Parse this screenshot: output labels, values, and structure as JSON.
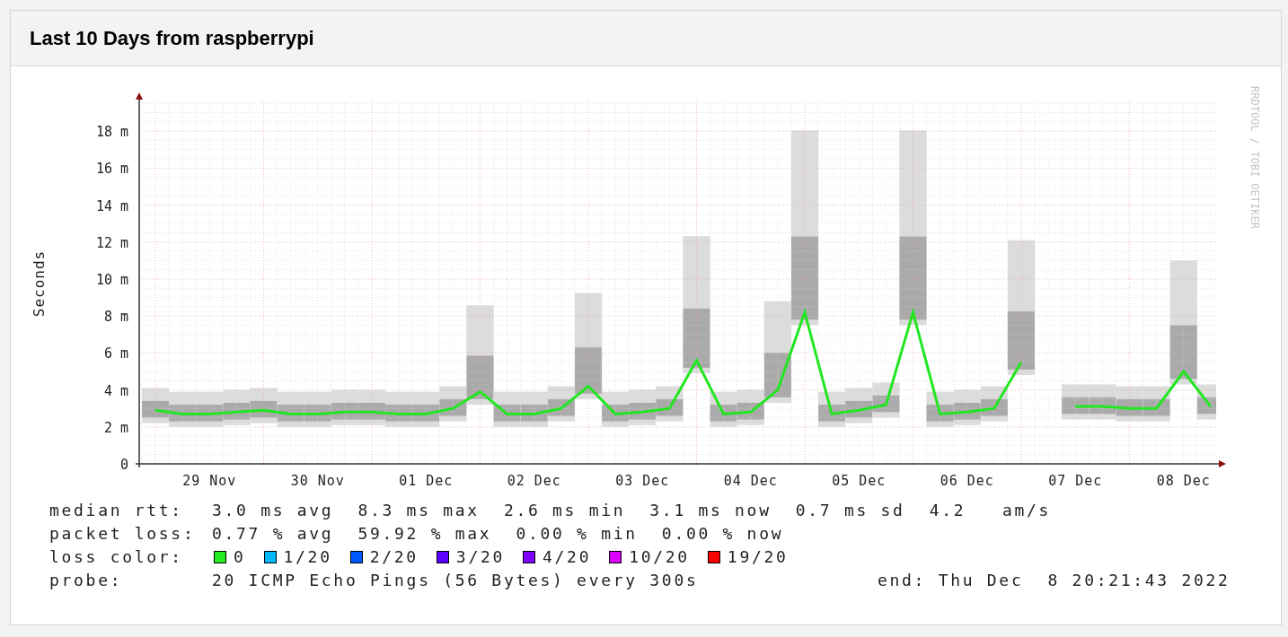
{
  "panel": {
    "title": "Last 10 Days from raspberrypi"
  },
  "graph": {
    "credit": "RRDTOOL / TOBI OETIKER",
    "chart_data": {
      "type": "line",
      "grid": true,
      "ylabel": "Seconds",
      "ylim": [
        0,
        20
      ],
      "yticks": [
        {
          "value": 0,
          "label": "0"
        },
        {
          "value": 2,
          "label": "2 m"
        },
        {
          "value": 4,
          "label": "4 m"
        },
        {
          "value": 6,
          "label": "6 m"
        },
        {
          "value": 8,
          "label": "8 m"
        },
        {
          "value": 10,
          "label": "10 m"
        },
        {
          "value": 12,
          "label": "12 m"
        },
        {
          "value": 14,
          "label": "14 m"
        },
        {
          "value": 16,
          "label": "16 m"
        },
        {
          "value": 18,
          "label": "18 m"
        }
      ],
      "categories": [
        null,
        null,
        "29 Nov",
        null,
        null,
        null,
        "30 Nov",
        null,
        null,
        null,
        "01 Dec",
        null,
        null,
        null,
        "02 Dec",
        null,
        null,
        null,
        "03 Dec",
        null,
        null,
        null,
        "04 Dec",
        null,
        null,
        null,
        "05 Dec",
        null,
        null,
        null,
        "06 Dec",
        null,
        null,
        null,
        "07 Dec",
        null,
        null,
        null,
        "08 Dec",
        null
      ],
      "series": [
        {
          "name": "median rtt:",
          "color": "#22e622",
          "values": [
            2.9,
            2.7,
            2.7,
            2.8,
            2.9,
            2.7,
            2.7,
            2.8,
            2.8,
            2.7,
            2.7,
            3.0,
            3.9,
            2.7,
            2.7,
            3.0,
            4.2,
            2.7,
            2.8,
            3.0,
            5.6,
            2.7,
            2.8,
            4.0,
            8.2,
            2.7,
            2.9,
            3.2,
            8.2,
            2.7,
            2.8,
            3.0,
            5.5,
            null,
            3.1,
            3.1,
            3.0,
            3.0,
            5.0,
            3.1
          ]
        }
      ]
    }
  },
  "legend": {
    "median_rtt": {
      "text": "3.0 ms avg  8.3 ms max  2.6 ms min  3.1 ms now  0.7 ms sd  4.2   am/s"
    },
    "packet_loss": {
      "label": "packet loss:",
      "text": "0.77 % avg  59.92 % max  0.00 % min  0.00 % now"
    },
    "loss_color": {
      "label": "loss color:",
      "items": [
        {
          "label": "0",
          "color": "#22ee22"
        },
        {
          "label": "1/20",
          "color": "#00b8ff"
        },
        {
          "label": "2/20",
          "color": "#0059ff"
        },
        {
          "label": "3/20",
          "color": "#5e00ff"
        },
        {
          "label": "4/20",
          "color": "#7e00ff"
        },
        {
          "label": "10/20",
          "color": "#dd00ff"
        },
        {
          "label": "19/20",
          "color": "#ff0000"
        }
      ]
    },
    "probe": {
      "label": "probe:",
      "text": "20 ICMP Echo Pings (56 Bytes) every 300s",
      "end": "end: Thu Dec  8 20:21:43 2022"
    }
  }
}
